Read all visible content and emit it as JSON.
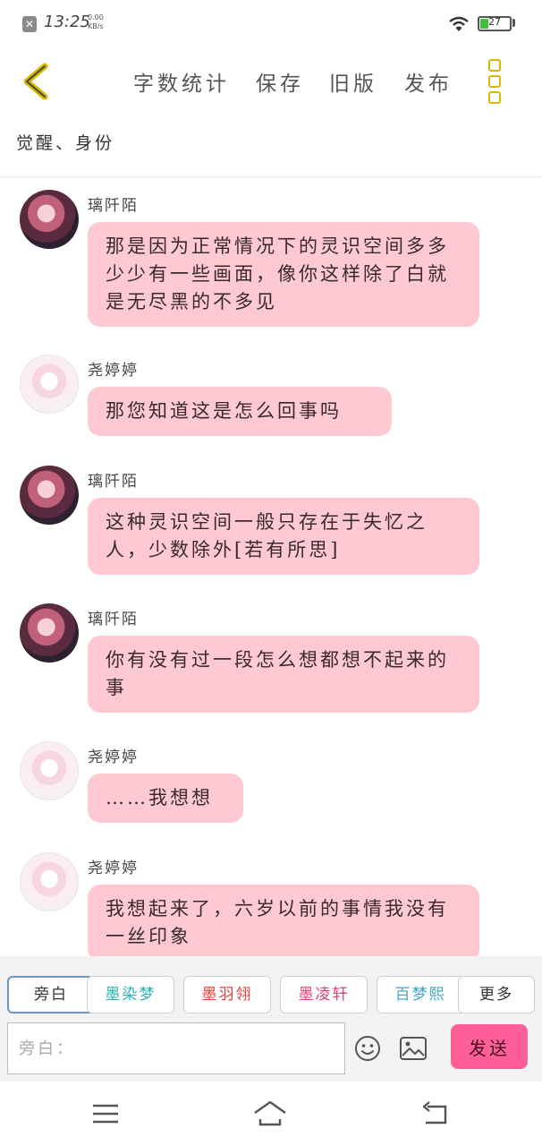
{
  "status_bar": {
    "time": "13:25",
    "speed_value": "0.00",
    "speed_unit": "KB/s",
    "battery": "27",
    "icons": [
      "notification-x-icon",
      "wifi-icon",
      "battery-icon"
    ]
  },
  "toolbar": {
    "back_icon": "chevron-left-icon",
    "word_count": "字数统计",
    "save": "保存",
    "old_version": "旧版",
    "publish": "发布",
    "more_icon": "more-vertical-icon"
  },
  "story": {
    "title": "觉醒、身份"
  },
  "messages": [
    {
      "sender": "璃阡陌",
      "avatar": "dark",
      "text": "那是因为正常情况下的灵识空间多多少少有一些画面，像你这样除了白就是无尽黑的不多见"
    },
    {
      "sender": "尧婷婷",
      "avatar": "light",
      "text": "那您知道这是怎么回事吗"
    },
    {
      "sender": "璃阡陌",
      "avatar": "dark",
      "text": "这种灵识空间一般只存在于失忆之人，少数除外[若有所思]"
    },
    {
      "sender": "璃阡陌",
      "avatar": "dark",
      "text": "你有没有过一段怎么想都想不起来的事"
    },
    {
      "sender": "尧婷婷",
      "avatar": "light",
      "text": "……我想想"
    },
    {
      "sender": "尧婷婷",
      "avatar": "light",
      "text": "我想起来了，六岁以前的事情我没有一丝印象"
    }
  ],
  "roles": [
    {
      "label": "旁白",
      "color": "#333333"
    },
    {
      "label": "墨染梦",
      "color": "#2ab5b0"
    },
    {
      "label": "墨羽翎",
      "color": "#e0403a"
    },
    {
      "label": "墨凌轩",
      "color": "#e0407a"
    },
    {
      "label": "百梦熙",
      "color": "#3aa6c8"
    },
    {
      "label": "更多",
      "color": "#333333"
    }
  ],
  "input": {
    "placeholder": "旁白：",
    "send": "发送",
    "emoji_icon": "emoji-icon",
    "image_icon": "image-icon"
  },
  "nav_bar": {
    "icons": [
      "menu-icon",
      "home-icon",
      "back-arrow-icon"
    ]
  },
  "colors": {
    "bubble": "#ffc9d4",
    "send_button": "#ff5f98",
    "back_icon": "#d8b800",
    "more_icon": "#d8b800"
  }
}
